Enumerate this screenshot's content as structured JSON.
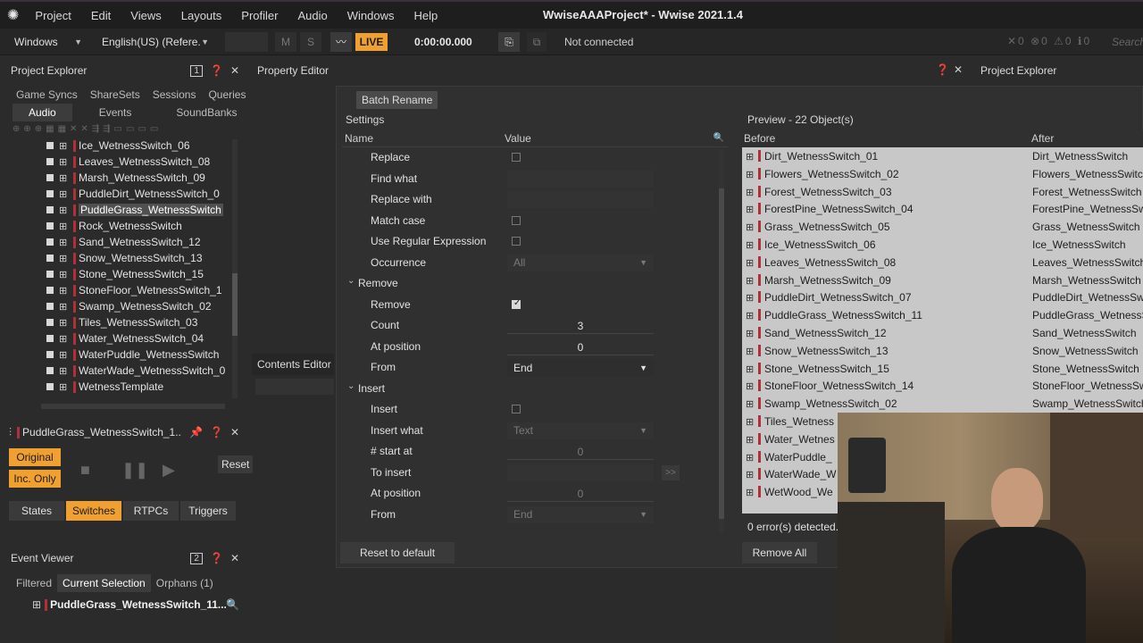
{
  "menu": {
    "items": [
      "Project",
      "Edit",
      "Views",
      "Layouts",
      "Profiler",
      "Audio",
      "Windows",
      "Help"
    ],
    "title": "WwiseAAAProject* - Wwise 2021.1.4"
  },
  "toolbar": {
    "platform": "Windows",
    "language": "English(US) (Refere...",
    "m": "M",
    "s": "S",
    "live": "LIVE",
    "time": "0:00:00.000",
    "connection": "Not connected",
    "search_placeholder": "Search"
  },
  "explorer": {
    "title": "Project Explorer",
    "badge": "1",
    "tabs_top": [
      "Game Syncs",
      "ShareSets",
      "Sessions",
      "Queries"
    ],
    "tabs_bottom": [
      "Audio",
      "Events",
      "SoundBanks"
    ],
    "items": [
      "Ice_WetnessSwitch_06",
      "Leaves_WetnessSwitch_08",
      "Marsh_WetnessSwitch_09",
      "PuddleDirt_WetnessSwitch_0",
      "PuddleGrass_WetnessSwitch",
      "Rock_WetnessSwitch",
      "Sand_WetnessSwitch_12",
      "Snow_WetnessSwitch_13",
      "Stone_WetnessSwitch_15",
      "StoneFloor_WetnessSwitch_1",
      "Swamp_WetnessSwitch_02",
      "Tiles_WetnessSwitch_03",
      "Water_WetnessSwitch_04",
      "WaterPuddle_WetnessSwitch",
      "WaterWade_WetnessSwitch_0",
      "WetnessTemplate"
    ]
  },
  "transport": {
    "title": "PuddleGrass_WetnessSwitch_1...",
    "original": "Original",
    "inc_only": "Inc. Only",
    "reset": "Reset",
    "tabs": [
      "States",
      "Switches",
      "RTPCs",
      "Triggers"
    ]
  },
  "event_viewer": {
    "title": "Event Viewer",
    "badge": "2",
    "tabs": [
      "Filtered",
      "Current Selection",
      "Orphans (1)"
    ],
    "item": "PuddleGrass_WetnessSwitch_11..."
  },
  "property_editor": {
    "title": "Property Editor"
  },
  "contents_editor": {
    "title": "Contents Editor"
  },
  "right_header": {
    "title": "Project Explorer"
  },
  "batch": {
    "tab": "Batch Rename",
    "settings": "Settings",
    "col_name": "Name",
    "col_value": "Value",
    "rows": [
      {
        "label": "Replace",
        "type": "check",
        "on": false
      },
      {
        "label": "Find what",
        "type": "field",
        "value": ""
      },
      {
        "label": "Replace with",
        "type": "field",
        "value": ""
      },
      {
        "label": "Match case",
        "type": "check",
        "on": false
      },
      {
        "label": "Use Regular Expression",
        "type": "check",
        "on": false
      },
      {
        "label": "Occurrence",
        "type": "select",
        "value": "All",
        "dim": true
      },
      {
        "label": "Remove",
        "type": "group"
      },
      {
        "label": "Remove",
        "type": "check",
        "on": true
      },
      {
        "label": "Count",
        "type": "num",
        "value": "3"
      },
      {
        "label": "At position",
        "type": "num",
        "value": "0"
      },
      {
        "label": "From",
        "type": "select",
        "value": "End",
        "dim": false
      },
      {
        "label": "Insert",
        "type": "group"
      },
      {
        "label": "Insert",
        "type": "check",
        "on": false
      },
      {
        "label": "Insert what",
        "type": "select",
        "value": "Text",
        "dim": true
      },
      {
        "label": "# start at",
        "type": "num",
        "value": "0",
        "dim": true
      },
      {
        "label": "To insert",
        "type": "field",
        "value": ""
      },
      {
        "label": "At position",
        "type": "num",
        "value": "0",
        "dim": true
      },
      {
        "label": "From",
        "type": "select",
        "value": "End",
        "dim": true
      }
    ],
    "reset": "Reset to default"
  },
  "preview": {
    "title": "Preview - 22 Object(s)",
    "col_before": "Before",
    "col_after": "After",
    "errors": "0 error(s) detected.",
    "remove_all": "Remove All",
    "rows": [
      {
        "before": "Dirt_WetnessSwitch_01",
        "after": "Dirt_WetnessSwitch"
      },
      {
        "before": "Flowers_WetnessSwitch_02",
        "after": "Flowers_WetnessSwitch"
      },
      {
        "before": "Forest_WetnessSwitch_03",
        "after": "Forest_WetnessSwitch"
      },
      {
        "before": "ForestPine_WetnessSwitch_04",
        "after": "ForestPine_WetnessSwit"
      },
      {
        "before": "Grass_WetnessSwitch_05",
        "after": "Grass_WetnessSwitch"
      },
      {
        "before": "Ice_WetnessSwitch_06",
        "after": "Ice_WetnessSwitch"
      },
      {
        "before": "Leaves_WetnessSwitch_08",
        "after": "Leaves_WetnessSwitch"
      },
      {
        "before": "Marsh_WetnessSwitch_09",
        "after": "Marsh_WetnessSwitch"
      },
      {
        "before": "PuddleDirt_WetnessSwitch_07",
        "after": "PuddleDirt_WetnessSwi"
      },
      {
        "before": "PuddleGrass_WetnessSwitch_11",
        "after": "PuddleGrass_WetnessSw"
      },
      {
        "before": "Sand_WetnessSwitch_12",
        "after": "Sand_WetnessSwitch"
      },
      {
        "before": "Snow_WetnessSwitch_13",
        "after": "Snow_WetnessSwitch"
      },
      {
        "before": "Stone_WetnessSwitch_15",
        "after": "Stone_WetnessSwitch"
      },
      {
        "before": "StoneFloor_WetnessSwitch_14",
        "after": "StoneFloor_WetnessSw"
      },
      {
        "before": "Swamp_WetnessSwitch_02",
        "after": "Swamp_WetnessSwitch"
      },
      {
        "before": "Tiles_Wetness",
        "after": ""
      },
      {
        "before": "Water_Wetnes",
        "after": ""
      },
      {
        "before": "WaterPuddle_",
        "after": ""
      },
      {
        "before": "WaterWade_W",
        "after": ""
      },
      {
        "before": "WetWood_We",
        "after": ""
      }
    ]
  }
}
